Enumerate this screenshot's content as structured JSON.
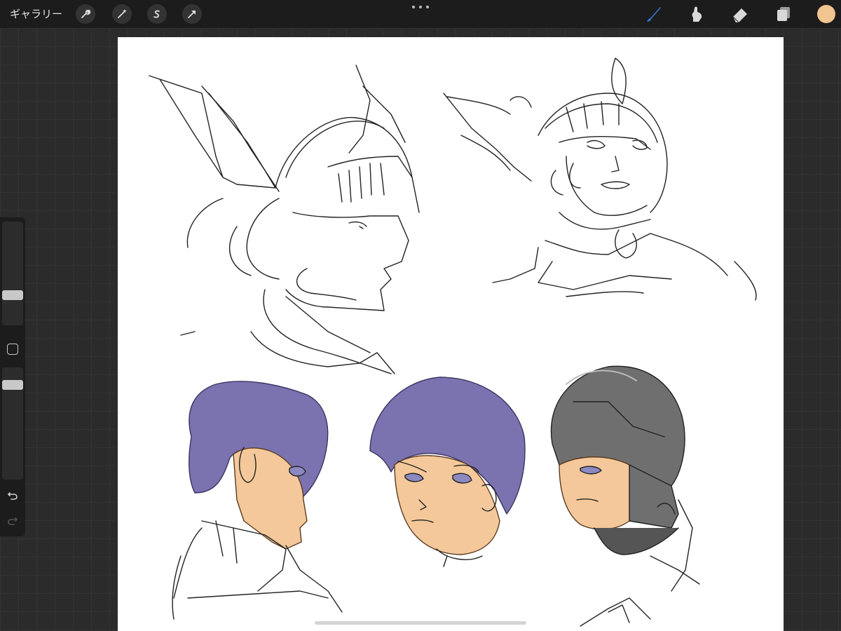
{
  "app": {
    "gallery_label": "ギャラリー"
  },
  "toolbar_left": [
    {
      "name": "actions-wrench-icon"
    },
    {
      "name": "adjustments-wand-icon"
    },
    {
      "name": "selection-s-icon"
    },
    {
      "name": "transform-arrow-icon"
    }
  ],
  "toolbar_right": [
    {
      "name": "brush-icon",
      "active": true
    },
    {
      "name": "smudge-icon",
      "active": false
    },
    {
      "name": "eraser-icon",
      "active": false
    },
    {
      "name": "layers-icon",
      "active": false
    }
  ],
  "colors": {
    "current_color": "#f1c58f",
    "active_tool": "#2f7de1",
    "hair_purple": "#7b72b0",
    "skin": "#f4c89a",
    "helmet_gray": "#6f6f6f"
  },
  "sidebar": {
    "brush_size_level": 0.27,
    "opacity_level": 0.12
  }
}
